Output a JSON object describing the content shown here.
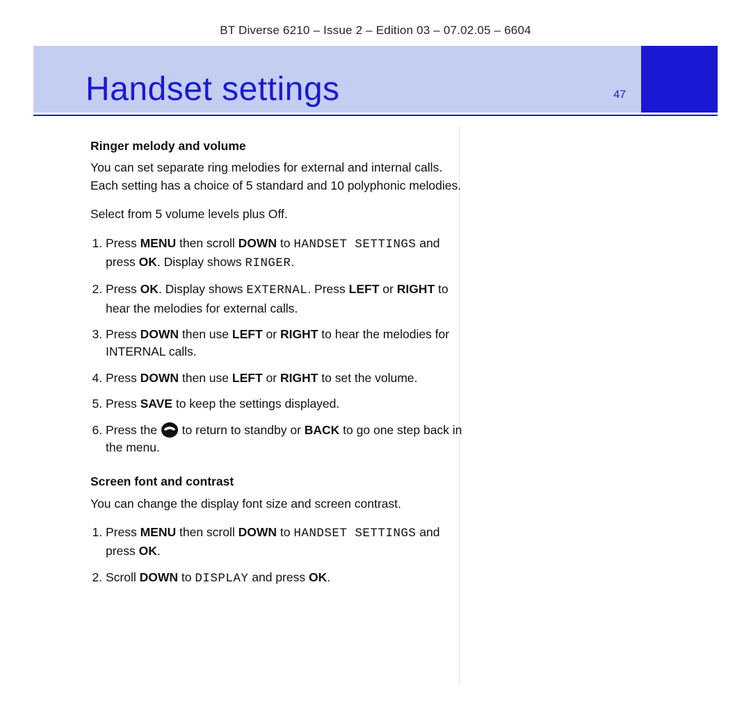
{
  "doc_header": "BT Diverse 6210 – Issue 2 – Edition 03 – 07.02.05 – 6604",
  "title": "Handset settings",
  "page_number": "47",
  "section1": {
    "heading": "Ringer melody and volume",
    "intro": "You can set separate ring melodies for external and internal calls. Each setting has a choice of 5 standard and 10 polyphonic melodies.",
    "intro2": "Select from 5 volume levels plus Off.",
    "step1_a": "Press ",
    "step1_b": "MENU",
    "step1_c": " then scroll ",
    "step1_d": "DOWN",
    "step1_e": " to ",
    "step1_mono1": "HANDSET SETTINGS",
    "step1_f": " and press ",
    "step1_g": "OK",
    "step1_h": ". Display shows ",
    "step1_mono2": "RINGER",
    "step1_i": ".",
    "step2_a": "Press ",
    "step2_b": "OK",
    "step2_c": ". Display shows ",
    "step2_mono1": "EXTERNAL",
    "step2_d": ". Press ",
    "step2_e": "LEFT",
    "step2_f": " or ",
    "step2_g": "RIGHT",
    "step2_h": " to hear the melodies for external calls.",
    "step3_a": "Press ",
    "step3_b": "DOWN",
    "step3_c": " then use ",
    "step3_d": "LEFT",
    "step3_e": " or ",
    "step3_f": "RIGHT",
    "step3_g": " to hear the melodies for INTERNAL calls.",
    "step4_a": "Press ",
    "step4_b": "DOWN",
    "step4_c": " then use ",
    "step4_d": "LEFT",
    "step4_e": " or ",
    "step4_f": "RIGHT",
    "step4_g": " to set the volume.",
    "step5_a": "Press ",
    "step5_b": "SAVE",
    "step5_c": " to keep the settings displayed.",
    "step6_a": "Press the ",
    "step6_b": " to return to standby or ",
    "step6_c": "BACK",
    "step6_d": " to go one step back in the menu."
  },
  "section2": {
    "heading": "Screen font and contrast",
    "intro": "You can change the display font size and screen contrast.",
    "step1_a": "Press ",
    "step1_b": "MENU",
    "step1_c": " then scroll ",
    "step1_d": "DOWN",
    "step1_e": " to ",
    "step1_mono1": "HANDSET SETTINGS",
    "step1_f": " and press ",
    "step1_g": "OK",
    "step1_h": ".",
    "step2_a": "Scroll ",
    "step2_b": "DOWN",
    "step2_c": " to ",
    "step2_mono1": "DISPLAY",
    "step2_d": " and press ",
    "step2_e": "OK",
    "step2_f": "."
  }
}
